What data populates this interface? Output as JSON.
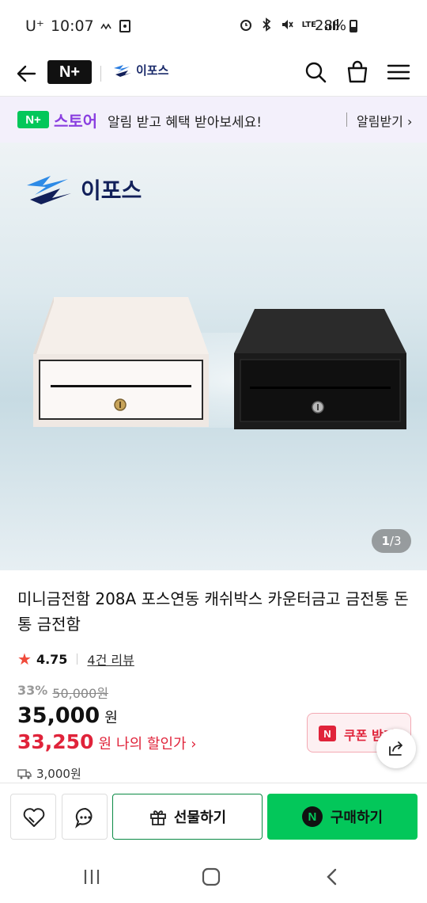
{
  "status": {
    "carrier": "U⁺",
    "time": "10:07",
    "network": "LTE",
    "battery": "28%"
  },
  "header": {
    "nplus": "N+",
    "brand": "이포스"
  },
  "banner": {
    "store_badge": "N+",
    "store": "스토어",
    "message": "알림 받고 혜택 받아보세요!",
    "cta": "알림받기 ›"
  },
  "hero": {
    "logo_text": "이포스",
    "pager_current": "1",
    "pager_total": "/3"
  },
  "product": {
    "title": "미니금전함 208A 포스연동 캐쉬박스 카운터금고 금전통 돈통 금전함",
    "rating": "4.75",
    "reviews": "4건 리뷰",
    "discount_rate": "33%",
    "original_price": "50,000원",
    "price": "35,000",
    "price_unit": "원",
    "my_price": "33,250",
    "my_price_unit": "원",
    "my_price_label": "나의 할인가 ›",
    "shipping": "3,000원"
  },
  "coupon": {
    "label": "쿠폰 받기"
  },
  "actions": {
    "gift": "선물하기",
    "buy": "구매하기",
    "buy_badge": "N"
  },
  "colors": {
    "naver_green": "#03c75a",
    "sale_red": "#e0233a",
    "store_purple": "#8a3fe0"
  }
}
